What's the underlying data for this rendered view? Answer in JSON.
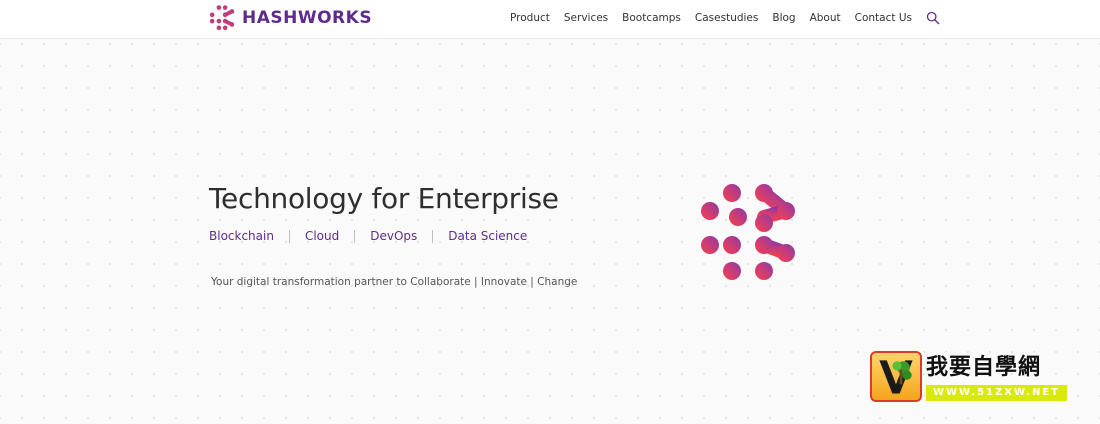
{
  "header": {
    "brand": {
      "name": "HASHWORKS",
      "logo_icon": "hashworks-logo-icon"
    },
    "nav": [
      {
        "label": "Product"
      },
      {
        "label": "Services"
      },
      {
        "label": "Bootcamps"
      },
      {
        "label": "Casestudies"
      },
      {
        "label": "Blog"
      },
      {
        "label": "About"
      },
      {
        "label": "Contact Us"
      }
    ],
    "search_icon": "search-icon"
  },
  "hero": {
    "title": "Technology for Enterprise",
    "links": [
      {
        "label": "Blockchain"
      },
      {
        "label": "Cloud"
      },
      {
        "label": "DevOps"
      },
      {
        "label": "Data Science"
      }
    ],
    "tagline": "Your digital transformation partner to Collaborate | Innovate | Change",
    "logo_icon": "hashworks-hero-logo-icon"
  },
  "watermark": {
    "text": "我要自學網",
    "url": "WWW.51ZXW.NET"
  },
  "colors": {
    "brand_purple": "#5f2c8b",
    "logo_red": "#ef3f4e",
    "logo_purple": "#8e3ea7"
  }
}
